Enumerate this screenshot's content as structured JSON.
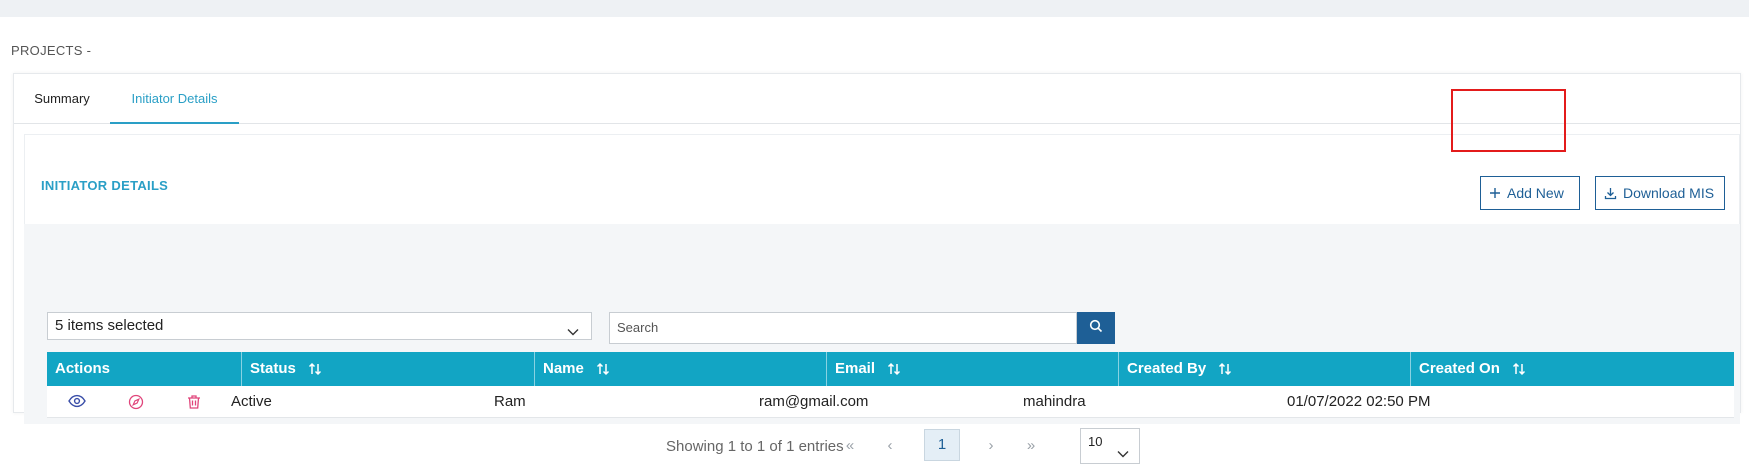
{
  "page": {
    "title": "PROJECTS -"
  },
  "tabs": [
    {
      "label": "Summary",
      "active": false
    },
    {
      "label": "Initiator Details",
      "active": true
    }
  ],
  "section": {
    "title": "INITIATOR DETAILS"
  },
  "buttons": {
    "add_new": "Add New",
    "download_mis": "Download MIS"
  },
  "filters": {
    "columns_select_value": "5 items selected",
    "search_placeholder": "Search"
  },
  "table": {
    "headers": [
      "Actions",
      "Status",
      "Name",
      "Email",
      "Created By",
      "Created On"
    ],
    "rows": [
      {
        "status": "Active",
        "name": "Ram",
        "email": "ram@gmail.com",
        "created_by": "mahindra",
        "created_on": "01/07/2022 02:50 PM"
      }
    ],
    "row_action_icons": [
      "eye-icon",
      "compass-icon",
      "trash-icon"
    ]
  },
  "pagination": {
    "info": "Showing 1 to 1 of 1 entries",
    "first": "«",
    "prev": "‹",
    "current_page": "1",
    "next": "›",
    "last": "»",
    "page_size": "10"
  },
  "colors": {
    "accent": "#12a5c4",
    "primary": "#1e5f96",
    "tab_active": "#2a9fc6",
    "highlight": "#e31b1b",
    "delete": "#e0457b"
  }
}
